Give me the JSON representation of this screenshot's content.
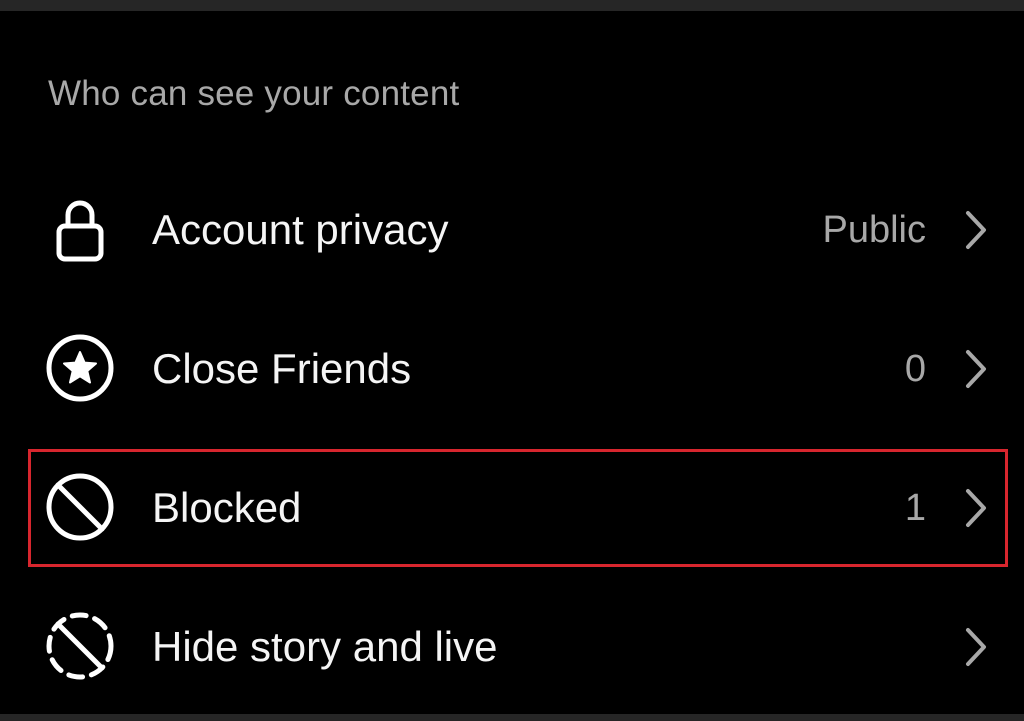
{
  "section": {
    "header": "Who can see your content"
  },
  "items": [
    {
      "label": "Account privacy",
      "value": "Public",
      "icon": "lock-icon"
    },
    {
      "label": "Close Friends",
      "value": "0",
      "icon": "star-circle-icon"
    },
    {
      "label": "Blocked",
      "value": "1",
      "icon": "blocked-icon"
    },
    {
      "label": "Hide story and live",
      "value": "",
      "icon": "hide-story-icon"
    }
  ],
  "colors": {
    "background": "#000000",
    "primary_text": "#f5f5f5",
    "secondary_text": "#a8a8a8",
    "highlight": "#d7262e"
  }
}
